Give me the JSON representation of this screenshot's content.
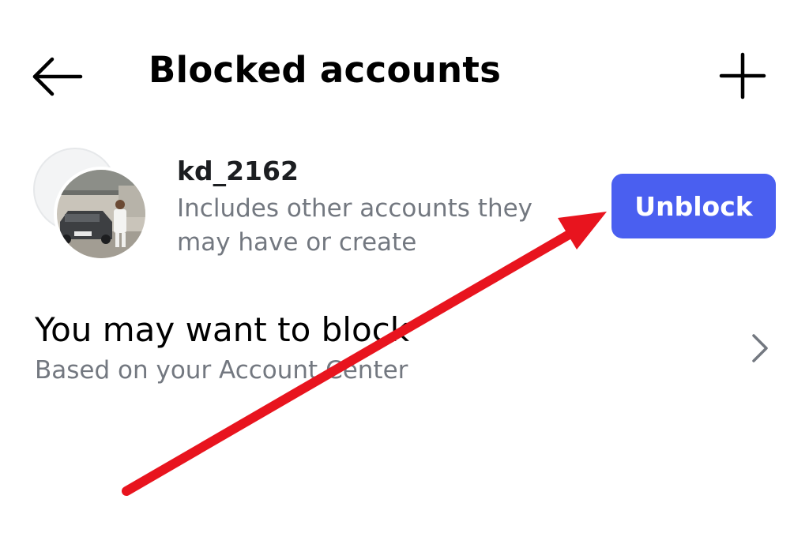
{
  "header": {
    "title": "Blocked accounts",
    "back_icon": "arrow-left-icon",
    "add_icon": "plus-icon"
  },
  "blocked_list": [
    {
      "username": "kd_2162",
      "note": "Includes other accounts they may have or create",
      "action_label": "Unblock"
    }
  ],
  "suggestion": {
    "title": "You may want to block",
    "subtitle": "Based on your Account Center",
    "chevron_icon": "chevron-right-icon"
  },
  "colors": {
    "accent": "#4a5ff0",
    "secondary_text": "#737880",
    "annotation": "#e8141e"
  },
  "annotation": {
    "icon": "red-arrow-pointing-at-unblock-button"
  }
}
